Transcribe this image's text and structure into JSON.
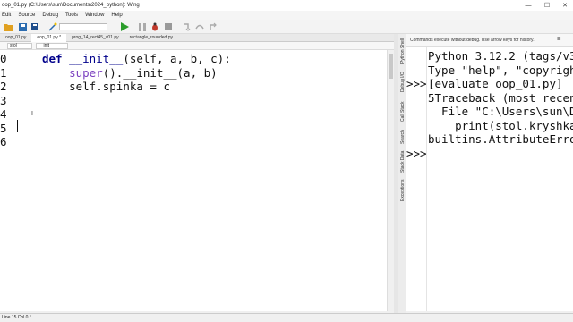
{
  "window": {
    "title": "oop_01.py (C:\\Users\\sun\\Documents\\2024_python): Wing",
    "controls": {
      "minimize": "—",
      "maximize": "☐",
      "close": "✕"
    }
  },
  "menu": [
    "Edit",
    "Source",
    "Debug",
    "Tools",
    "Window",
    "Help"
  ],
  "tabs": [
    {
      "label": "oop_01.py",
      "active": false
    },
    {
      "label": "oop_01.py *",
      "active": true
    },
    {
      "label": "prog_14_rect45_v01.py",
      "active": false
    },
    {
      "label": "rectangle_rounded.py",
      "active": false
    }
  ],
  "tabs_more": "▸",
  "selectors": {
    "scope": "stol",
    "method": "__init__"
  },
  "editor": {
    "lines": [
      {
        "num": "0",
        "def": "def ",
        "fn": "__init__",
        "rest": "(self, a, b, c):"
      },
      {
        "num": "1",
        "indent": "    ",
        "bi": "super",
        "rest": "().__init__(a, b)"
      },
      {
        "num": "2",
        "indent": "    ",
        "rest": "self.spinka = c"
      },
      {
        "num": "3",
        "rest": ""
      },
      {
        "num": "4",
        "rest": ""
      },
      {
        "num": "5",
        "rest": ""
      },
      {
        "num": "6",
        "rest": ""
      }
    ]
  },
  "side_tools": [
    "Python Shell",
    "Debug I/O",
    "Call Stack",
    "Search",
    "Stack Data",
    "Exceptions"
  ],
  "shell": {
    "header": "Commands execute without debug.  Use arrow keys for history.",
    "options_icon": "☰",
    "prompts": [
      ">>>",
      ">>>"
    ],
    "lines": [
      "Python 3.12.2 (tags/v3.",
      "Type \"help\", \"copyright",
      "[evaluate oop_01.py]",
      "5Traceback (most recent",
      "  File \"C:\\Users\\sun\\Do",
      "    print(stol.kryshka)",
      "builtins.AttributeError"
    ]
  },
  "status": {
    "text": "Line 15 Col 0 *"
  },
  "colors": {
    "keyword": "#00008b",
    "builtin": "#7a3fbf",
    "run": "#2a9d2a",
    "debug": "#c0392b"
  }
}
